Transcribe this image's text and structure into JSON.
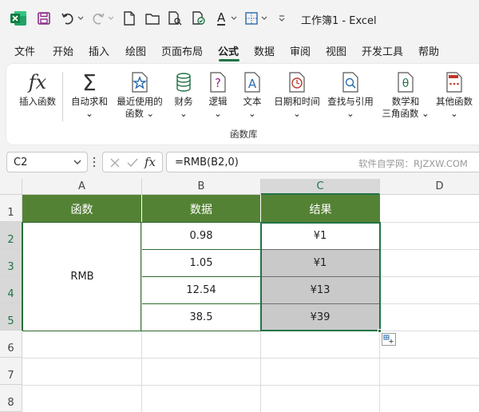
{
  "titlebar": {
    "title": "工作簿1 - Excel",
    "font_letter": "A"
  },
  "menu": {
    "tabs": [
      {
        "label": "文件"
      },
      {
        "label": "开始"
      },
      {
        "label": "插入"
      },
      {
        "label": "绘图"
      },
      {
        "label": "页面布局"
      },
      {
        "label": "公式",
        "active": true
      },
      {
        "label": "数据"
      },
      {
        "label": "审阅"
      },
      {
        "label": "视图"
      },
      {
        "label": "开发工具"
      },
      {
        "label": "帮助"
      }
    ]
  },
  "ribbon": {
    "group_label": "函数库",
    "buttons": [
      {
        "name": "insert-function",
        "label": "插入函数"
      },
      {
        "name": "autosum",
        "label": "自动求和"
      },
      {
        "name": "recently-used",
        "label": "最近使用的",
        "label2": "函数"
      },
      {
        "name": "financial",
        "label": "财务"
      },
      {
        "name": "logical",
        "label": "逻辑"
      },
      {
        "name": "text",
        "label": "文本"
      },
      {
        "name": "date-time",
        "label": "日期和时间"
      },
      {
        "name": "lookup",
        "label": "查找与引用"
      },
      {
        "name": "math-trig",
        "label": "数学和",
        "label2": "三角函数"
      },
      {
        "name": "more-functions",
        "label": "其他函数"
      }
    ]
  },
  "formula_bar": {
    "name_box": "C2",
    "formula": "=RMB(B2,0)",
    "watermark": "软件自学网：RJZXW.COM",
    "fx": "fx"
  },
  "sheet": {
    "columns": [
      "A",
      "B",
      "C",
      "D"
    ],
    "rows": [
      "1",
      "2",
      "3",
      "4",
      "5",
      "6",
      "7",
      "8"
    ],
    "header": [
      "函数",
      "数据",
      "结果"
    ],
    "function_name": "RMB",
    "data": [
      "0.98",
      "1.05",
      "12.54",
      "38.5"
    ],
    "results": [
      "¥1",
      "¥1",
      "¥13",
      "¥39"
    ]
  },
  "colors": {
    "accent": "#217346",
    "header_fill": "#548235",
    "result_fill": "#c9c9c9"
  }
}
